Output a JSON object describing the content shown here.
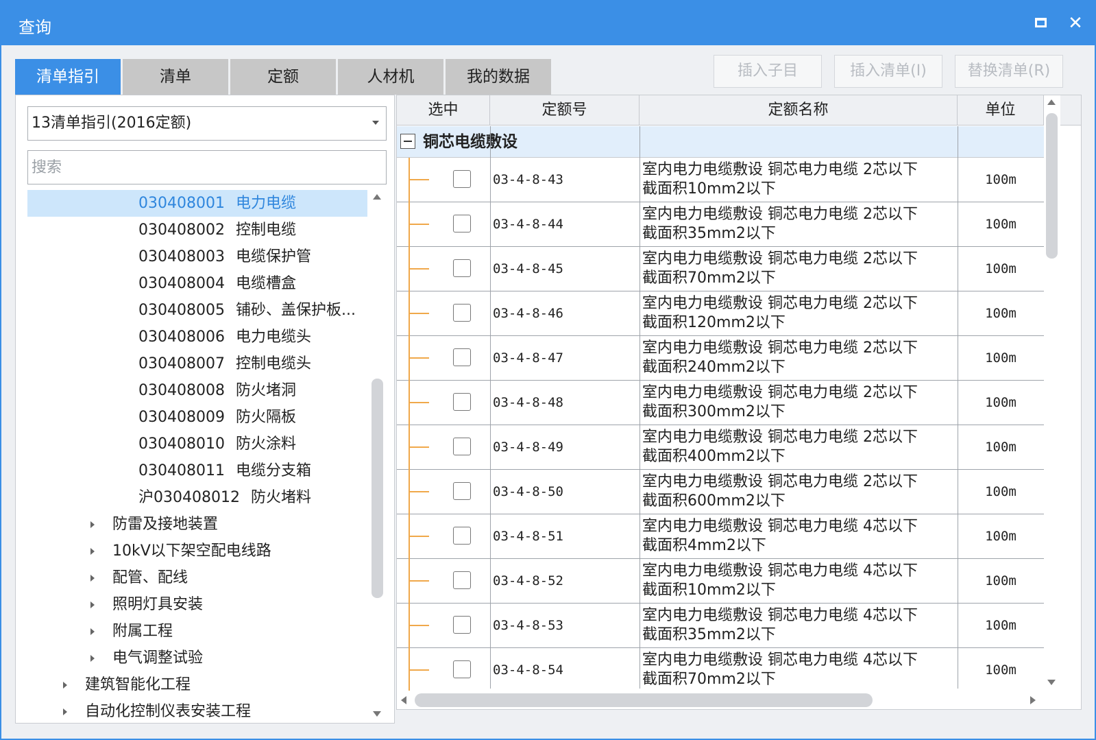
{
  "window": {
    "title": "查询"
  },
  "tabs": [
    {
      "label": "清单指引",
      "active": true
    },
    {
      "label": "清单",
      "active": false
    },
    {
      "label": "定额",
      "active": false
    },
    {
      "label": "人材机",
      "active": false
    },
    {
      "label": "我的数据",
      "active": false
    }
  ],
  "actions": {
    "insert_child": "插入子目",
    "insert_list": "插入清单(I)",
    "replace_list": "替换清单(R)"
  },
  "left": {
    "dropdown_value": "13清单指引(2016定额)",
    "search_placeholder": "搜索",
    "items": [
      {
        "code": "030408001",
        "name": "电力电缆"
      },
      {
        "code": "030408002",
        "name": "控制电缆"
      },
      {
        "code": "030408003",
        "name": "电缆保护管"
      },
      {
        "code": "030408004",
        "name": "电缆槽盒"
      },
      {
        "code": "030408005",
        "name": "铺砂、盖保护板..."
      },
      {
        "code": "030408006",
        "name": "电力电缆头"
      },
      {
        "code": "030408007",
        "name": "控制电缆头"
      },
      {
        "code": "030408008",
        "name": "防火堵洞"
      },
      {
        "code": "030408009",
        "name": "防火隔板"
      },
      {
        "code": "030408010",
        "name": "防火涂料"
      },
      {
        "code": "030408011",
        "name": "电缆分支箱"
      },
      {
        "code": "沪030408012",
        "name": "防火堵料"
      }
    ],
    "groups": [
      {
        "label": "防雷及接地装置"
      },
      {
        "label": "10kV以下架空配电线路"
      },
      {
        "label": "配管、配线"
      },
      {
        "label": "照明灯具安装"
      },
      {
        "label": "附属工程"
      },
      {
        "label": "电气调整试验"
      }
    ],
    "top_group": "建筑智能化工程",
    "cut_group": "自动化控制仪表安装工程"
  },
  "grid": {
    "columns": [
      "选中",
      "定额号",
      "定额名称",
      "单位"
    ],
    "group_title": "铜芯电缆敷设",
    "rows": [
      {
        "code": "03-4-8-43",
        "name1": "室内电力电缆敷设 铜芯电力电缆 2芯以下",
        "name2": "截面积10mm2以下",
        "unit": "100m"
      },
      {
        "code": "03-4-8-44",
        "name1": "室内电力电缆敷设 铜芯电力电缆 2芯以下",
        "name2": "截面积35mm2以下",
        "unit": "100m"
      },
      {
        "code": "03-4-8-45",
        "name1": "室内电力电缆敷设 铜芯电力电缆 2芯以下",
        "name2": "截面积70mm2以下",
        "unit": "100m"
      },
      {
        "code": "03-4-8-46",
        "name1": "室内电力电缆敷设 铜芯电力电缆 2芯以下",
        "name2": "截面积120mm2以下",
        "unit": "100m"
      },
      {
        "code": "03-4-8-47",
        "name1": "室内电力电缆敷设 铜芯电力电缆 2芯以下",
        "name2": "截面积240mm2以下",
        "unit": "100m"
      },
      {
        "code": "03-4-8-48",
        "name1": "室内电力电缆敷设 铜芯电力电缆 2芯以下",
        "name2": "截面积300mm2以下",
        "unit": "100m"
      },
      {
        "code": "03-4-8-49",
        "name1": "室内电力电缆敷设 铜芯电力电缆 2芯以下",
        "name2": "截面积400mm2以下",
        "unit": "100m"
      },
      {
        "code": "03-4-8-50",
        "name1": "室内电力电缆敷设 铜芯电力电缆 2芯以下",
        "name2": "截面积600mm2以下",
        "unit": "100m"
      },
      {
        "code": "03-4-8-51",
        "name1": "室内电力电缆敷设 铜芯电力电缆 4芯以下",
        "name2": "截面积4mm2以下",
        "unit": "100m"
      },
      {
        "code": "03-4-8-52",
        "name1": "室内电力电缆敷设 铜芯电力电缆 4芯以下",
        "name2": "截面积10mm2以下",
        "unit": "100m"
      },
      {
        "code": "03-4-8-53",
        "name1": "室内电力电缆敷设 铜芯电力电缆 4芯以下",
        "name2": "截面积35mm2以下",
        "unit": "100m"
      },
      {
        "code": "03-4-8-54",
        "name1": "室内电力电缆敷设 铜芯电力电缆 4芯以下",
        "name2": "截面积70mm2以下",
        "unit": "100m"
      }
    ]
  }
}
